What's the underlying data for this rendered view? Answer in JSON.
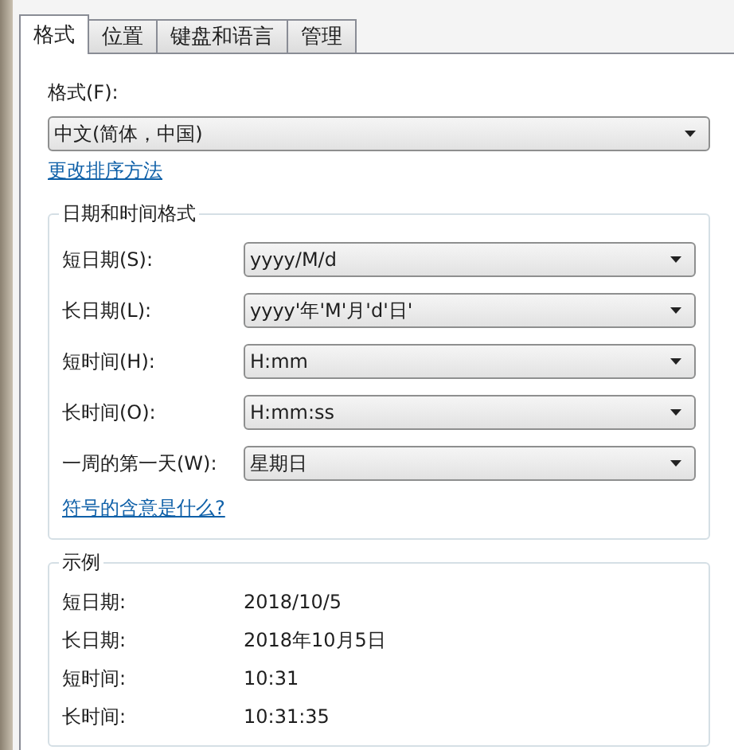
{
  "tabs": [
    {
      "label": "格式",
      "selected": true
    },
    {
      "label": "位置",
      "selected": false
    },
    {
      "label": "键盘和语言",
      "selected": false
    },
    {
      "label": "管理",
      "selected": false
    }
  ],
  "format": {
    "label": "格式(F):",
    "value": "中文(简体，中国)",
    "link": "更改排序方法"
  },
  "date_time_formats": {
    "title": "日期和时间格式",
    "rows": [
      {
        "label": "短日期(S):",
        "value": "yyyy/M/d"
      },
      {
        "label": "长日期(L):",
        "value": "yyyy'年'M'月'd'日'"
      },
      {
        "label": "短时间(H):",
        "value": "H:mm"
      },
      {
        "label": "长时间(O):",
        "value": "H:mm:ss"
      },
      {
        "label": "一周的第一天(W):",
        "value": "星期日"
      }
    ],
    "link": "符号的含意是什么?"
  },
  "examples": {
    "title": "示例",
    "rows": [
      {
        "label": "短日期:",
        "value": "2018/10/5"
      },
      {
        "label": "长日期:",
        "value": "2018年10月5日"
      },
      {
        "label": "短时间:",
        "value": "10:31"
      },
      {
        "label": "长时间:",
        "value": "10:31:35"
      }
    ]
  }
}
